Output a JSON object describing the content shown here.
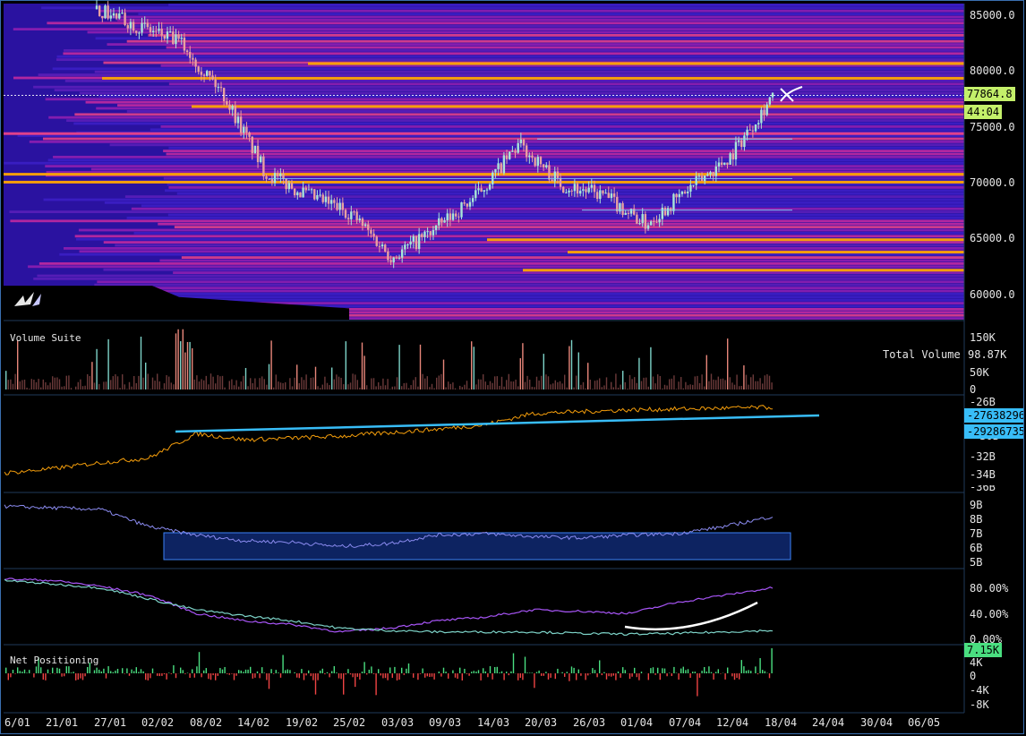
{
  "colors": {
    "background": "#000000",
    "heatmap_low": "#3a1fb0",
    "heatmap_mid": "#a21caf",
    "heatmap_high": "#f59e0b",
    "candle_up": "#a8e6d8",
    "candle_down": "#e8a0a0",
    "cumulative_line": "#f59e0b",
    "trendline": "#38bdf8",
    "oi_line": "#8b8bf0",
    "range_box": "#1d4ed8",
    "ratio_line_a": "#a855f7",
    "ratio_line_b": "#7dd3c8",
    "net_up": "#4ade80",
    "net_down": "#ef4444",
    "price_tag": "#c4f06a",
    "aux_tag": "#38bdf8"
  },
  "icons": {
    "logo": "brand-logo-icon",
    "cursor": "x-cursor-icon"
  },
  "price_panel": {
    "y_ticks": [
      "85000.0",
      "80000.0",
      "75000.0",
      "70000.0",
      "65000.0",
      "60000.0"
    ],
    "current_price": "77864.8",
    "countdown": "44:04"
  },
  "volume_panel": {
    "label": "Volume Suite",
    "total_label": "Total Volume",
    "total_value": "98.87K",
    "y_ticks": [
      "150K",
      "50K",
      "0"
    ]
  },
  "cumulative_panel": {
    "y_ticks": [
      "-26B",
      "-32B",
      "-34B"
    ],
    "cut_tick_top": "-30B",
    "cut_tick_bottom": "-36B",
    "value_a": "-27638296",
    "value_b": "-29286735"
  },
  "oi_panel": {
    "y_ticks": [
      "9B",
      "8B",
      "7B",
      "6B",
      "5B"
    ]
  },
  "ratio_panel": {
    "y_ticks": [
      "80.00%",
      "40.00%",
      "0.00%"
    ]
  },
  "net_panel": {
    "label": "Net Positioning",
    "current_value": "7.15K",
    "y_ticks": [
      "4K",
      "0",
      "-4K",
      "-8K"
    ]
  },
  "x_axis": [
    "6/01",
    "21/01",
    "27/01",
    "02/02",
    "08/02",
    "14/02",
    "19/02",
    "25/02",
    "03/03",
    "09/03",
    "14/03",
    "20/03",
    "26/03",
    "01/04",
    "07/04",
    "12/04",
    "18/04",
    "24/04",
    "30/04",
    "06/05"
  ],
  "chart_data": {
    "type": "line",
    "x": [
      "6/01",
      "21/01",
      "27/01",
      "02/02",
      "08/02",
      "14/02",
      "19/02",
      "25/02",
      "03/03",
      "09/03",
      "14/03",
      "20/03",
      "26/03",
      "01/04",
      "07/04",
      "12/04",
      "18/04"
    ],
    "price_ylim": [
      58000,
      86000
    ],
    "series": [
      {
        "values": [
          85500,
          84000,
          82500,
          78000,
          71000,
          69000,
          67500,
          63500,
          66000,
          69000,
          73500,
          70000,
          69000,
          66500,
          69500,
          72500,
          77864.8
        ]
      }
    ],
    "cumulative_ylim": [
      -36,
      -26
    ],
    "cumulative": [
      -34,
      -33.5,
      -32.8,
      -32.3,
      -29.5,
      -30.2,
      -30,
      -29.8,
      -29.4,
      -29,
      -28.5,
      -27.2,
      -27,
      -26.8,
      -26.7,
      -26.6,
      -26.5
    ],
    "oi_ylim": [
      5,
      9
    ],
    "oi": [
      8.9,
      8.8,
      8.7,
      7.5,
      6.9,
      6.5,
      6.4,
      6.1,
      6.3,
      6.9,
      7.0,
      6.8,
      6.7,
      6.9,
      7.0,
      7.5,
      8.2
    ],
    "ratio_ylim": [
      0,
      90
    ],
    "ratio_a": [
      82,
      80,
      72,
      60,
      35,
      25,
      20,
      10,
      15,
      25,
      30,
      40,
      38,
      35,
      50,
      60,
      70
    ],
    "ratio_b": [
      80,
      75,
      70,
      55,
      40,
      32,
      25,
      15,
      12,
      10,
      10,
      10,
      8,
      7,
      8,
      10,
      12
    ]
  }
}
